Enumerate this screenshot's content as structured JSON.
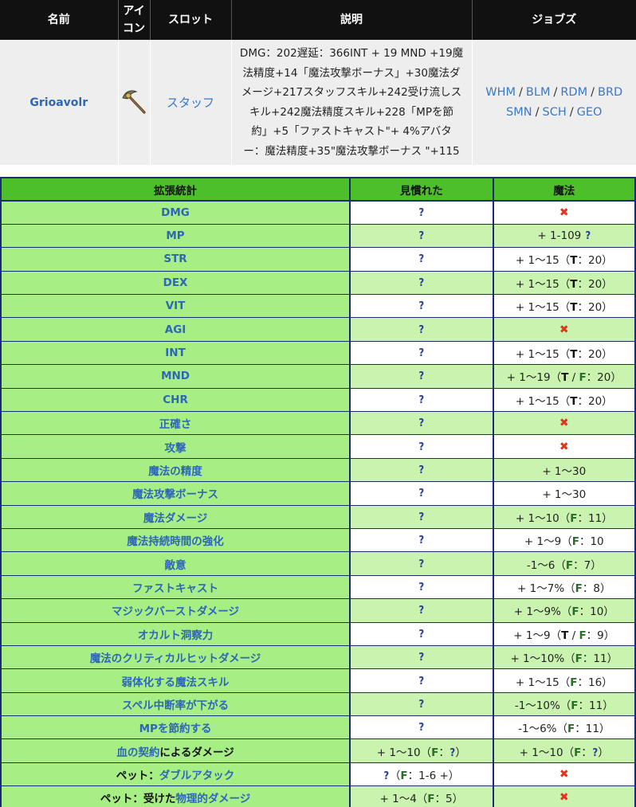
{
  "item_headers": {
    "name": "名前",
    "icon": "アイコン",
    "slot": "スロット",
    "desc": "説明",
    "jobs": "ジョブズ"
  },
  "item": {
    "name": "Grioavolr",
    "icon": "staff-icon",
    "slot": "スタッフ",
    "desc_lines": [
      "DMG：202遅延：366INT + 19 MND +19魔",
      "法精度+14「魔法攻撃ボーナス」+30魔法ダ",
      "メージ+217スタッフスキル+242受け流しス",
      "キル+242魔法精度スキル+228「MPを節",
      "約」+5「ファストキャスト\"+ 4%アバタ",
      "ー：魔法精度+35\"魔法攻撃ボーナス \"+115"
    ],
    "jobs_line1": [
      "WHM",
      "BLM",
      "RDM",
      "BRD"
    ],
    "jobs_line2": [
      "SMN",
      "SCH",
      "GEO"
    ]
  },
  "stats_headers": {
    "stat": "拡張統計",
    "familiar": "見慣れた",
    "magic": "魔法"
  },
  "colors": {
    "header_green": "#4dbf2a",
    "name_cell_green": "#a7ee85",
    "row_light_green": "#c9f3ae",
    "border_navy": "#1c2c70",
    "link_blue": "#2e66b8",
    "cross_red": "#e0351c"
  },
  "stats_rows": [
    {
      "name": "DMG",
      "familiar": "?",
      "magic": "✖"
    },
    {
      "name": "MP",
      "familiar": "?",
      "magic": "+ 1-109 ?"
    },
    {
      "name": "STR",
      "familiar": "?",
      "magic": "+ 1～15（T：20）"
    },
    {
      "name": "DEX",
      "familiar": "?",
      "magic": "+ 1～15（T：20）"
    },
    {
      "name": "VIT",
      "familiar": "?",
      "magic": "+ 1～15（T：20）"
    },
    {
      "name": "AGI",
      "familiar": "?",
      "magic": "✖"
    },
    {
      "name": "INT",
      "familiar": "?",
      "magic": "+ 1～15（T：20）"
    },
    {
      "name": "MND",
      "familiar": "?",
      "magic": "+ 1～19（T / F：20）"
    },
    {
      "name": "CHR",
      "familiar": "?",
      "magic": "+ 1～15（T：20）"
    },
    {
      "name": "正確さ",
      "familiar": "?",
      "magic": "✖"
    },
    {
      "name": "攻撃",
      "familiar": "?",
      "magic": "✖"
    },
    {
      "name": "魔法の精度",
      "familiar": "?",
      "magic": "+ 1～30"
    },
    {
      "name": "魔法攻撃ボーナス",
      "familiar": "?",
      "magic": "+ 1～30"
    },
    {
      "name": "魔法ダメージ",
      "familiar": "?",
      "magic": "+ 1～10（F：11）"
    },
    {
      "name": "魔法持続時間の強化",
      "familiar": "?",
      "magic": "+ 1～9（F：10"
    },
    {
      "name": "敵意",
      "familiar": "?",
      "magic": "-1～6（F：7）"
    },
    {
      "name": "ファストキャスト",
      "familiar": "?",
      "magic": "+ 1～7%（F：8）"
    },
    {
      "name": "マジックバーストダメージ",
      "familiar": "?",
      "magic": "+ 1～9%（F：10）"
    },
    {
      "name": "オカルト洞察力",
      "familiar": "?",
      "magic": "+ 1～9（T / F：9）"
    },
    {
      "name": "魔法のクリティカルヒットダメージ",
      "familiar": "?",
      "magic": "+ 1～10%（F：11）"
    },
    {
      "name": "弱体化する魔法スキル",
      "familiar": "?",
      "magic": "+ 1～15（F：16）"
    },
    {
      "name": "スペル中断率が下がる",
      "familiar": "?",
      "magic": "-1～10%（F：11）"
    },
    {
      "name": "MPを節約する",
      "familiar": "?",
      "magic": "-1～6%（F：11）"
    },
    {
      "name_link": "血の契約",
      "name_plain": "によるダメージ",
      "familiar": "+ 1～10（F：?）",
      "magic": "+ 1～10（F：?）"
    },
    {
      "name_plain": "ペット：",
      "name_link": "ダブルアタック",
      "familiar": "?（F：1-6 +）",
      "magic": "✖"
    },
    {
      "name_plain": "ペット：受けた",
      "name_link": "物理的ダメージ",
      "familiar": "+ 1～4（F：5）",
      "magic": "✖"
    }
  ]
}
